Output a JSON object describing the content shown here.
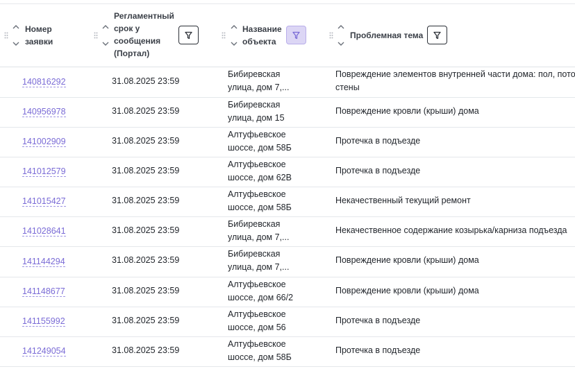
{
  "headers": {
    "number": "Номер\nзаявки",
    "deadline": "Регламентный\nсрок у\nсообщения\n(Портал)",
    "object": "Название\nобъекта",
    "topic": "Проблемная тема"
  },
  "icons": {
    "sort": "sort-arrows-icon",
    "drag": "drag-handle-icon",
    "filter": "filter-icon"
  },
  "colors": {
    "link": "#7a6bd6",
    "filter_active_bg": "#dcd6f5"
  },
  "rows": [
    {
      "number": "140816292",
      "deadline": "31.08.2025 23:59",
      "object": "Бибиревская\nулица, дом 7,...",
      "topic": "Повреждение элементов внутренней части дома: пол, потолок,\nстены"
    },
    {
      "number": "140956978",
      "deadline": "31.08.2025 23:59",
      "object": "Бибиревская\nулица, дом 15",
      "topic": "Повреждение кровли (крыши) дома"
    },
    {
      "number": "141002909",
      "deadline": "31.08.2025 23:59",
      "object": "Алтуфьевское\nшоссе, дом 58Б",
      "topic": "Протечка в подъезде"
    },
    {
      "number": "141012579",
      "deadline": "31.08.2025 23:59",
      "object": "Алтуфьевское\nшоссе, дом 62В",
      "topic": "Протечка в подъезде"
    },
    {
      "number": "141015427",
      "deadline": "31.08.2025 23:59",
      "object": "Алтуфьевское\nшоссе, дом 58Б",
      "topic": "Некачественный текущий ремонт"
    },
    {
      "number": "141028641",
      "deadline": "31.08.2025 23:59",
      "object": "Бибиревская\nулица, дом 7,...",
      "topic": "Некачественное содержание козырька/карниза подъезда"
    },
    {
      "number": "141144294",
      "deadline": "31.08.2025 23:59",
      "object": "Бибиревская\nулица, дом 7,...",
      "topic": "Повреждение кровли (крыши) дома"
    },
    {
      "number": "141148677",
      "deadline": "31.08.2025 23:59",
      "object": "Алтуфьевское\nшоссе, дом 66/2",
      "topic": "Повреждение кровли (крыши) дома"
    },
    {
      "number": "141155992",
      "deadline": "31.08.2025 23:59",
      "object": "Алтуфьевское\nшоссе, дом 56",
      "topic": "Протечка в подъезде"
    },
    {
      "number": "141249054",
      "deadline": "31.08.2025 23:59",
      "object": "Алтуфьевское\nшоссе, дом 58Б",
      "topic": "Протечка в подъезде"
    }
  ]
}
